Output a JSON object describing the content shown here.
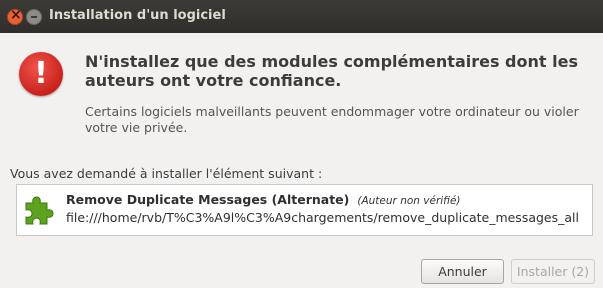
{
  "window": {
    "title": "Installation d'un logiciel"
  },
  "dialog": {
    "icon": "warning-exclamation-icon",
    "headline": "N'installez que des modules complémentaires dont les auteurs ont votre confiance.",
    "description": "Certains logiciels malveillants peuvent endommager votre ordinateur ou violer votre vie privée.",
    "request_text": "Vous avez demandé à installer l'élément suivant :",
    "addon": {
      "icon": "puzzle-piece-icon",
      "name": "Remove Duplicate Messages (Alternate)",
      "note": "(Auteur non vérifié)",
      "url": "file:///home/rvb/T%C3%A9l%C3%A9chargements/remove_duplicate_messages_all"
    },
    "buttons": {
      "cancel": "Annuler",
      "install": "Installer (2)"
    }
  },
  "colors": {
    "titlebar": "#3c3b37",
    "warning": "#d7281f",
    "puzzle": "#4e9a06"
  }
}
